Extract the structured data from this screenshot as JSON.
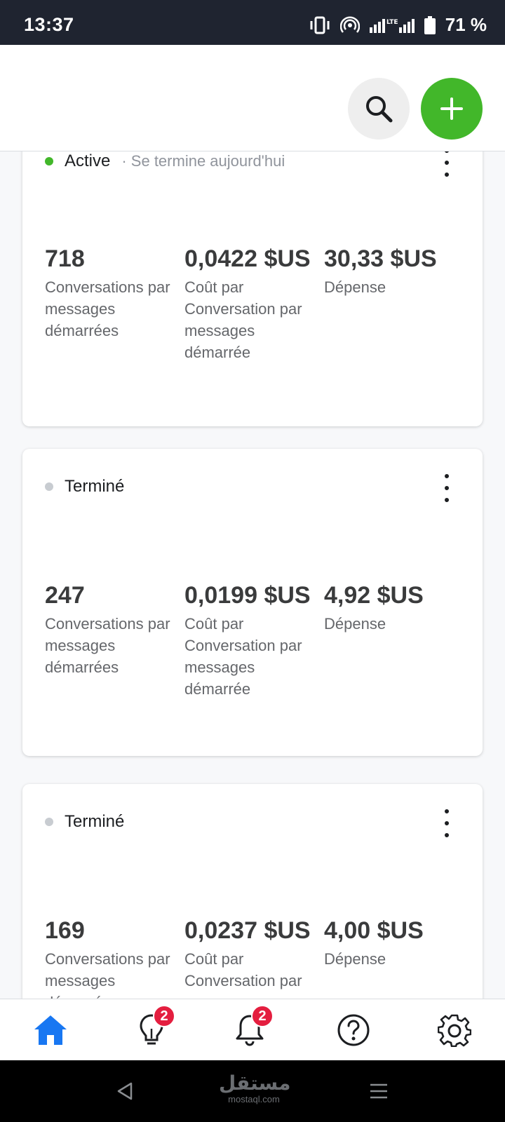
{
  "status_bar": {
    "time": "13:37",
    "battery": "71 %",
    "network": "LTE"
  },
  "header": {
    "search_icon": "search-icon",
    "create_icon": "plus-icon"
  },
  "cards": [
    {
      "status": "Active",
      "status_sub": "· Se termine aujourd'hui",
      "metrics": [
        {
          "value": "718",
          "label": "Conversations par messages démarrées"
        },
        {
          "value": "0,0422 $US",
          "label": "Coût par Conversation par messages démarrée"
        },
        {
          "value": "30,33 $US",
          "label": "Dépense"
        }
      ]
    },
    {
      "status": "Terminé",
      "metrics": [
        {
          "value": "247",
          "label": "Conversations par messages démarrées"
        },
        {
          "value": "0,0199 $US",
          "label": "Coût par Conversation par messages démarrée"
        },
        {
          "value": "4,92 $US",
          "label": "Dépense"
        }
      ]
    },
    {
      "status": "Terminé",
      "metrics": [
        {
          "value": "169",
          "label": "Conversations par messages démarrées"
        },
        {
          "value": "0,0237 $US",
          "label": "Coût par Conversation par messages démarrée"
        },
        {
          "value": "4,00 $US",
          "label": "Dépense"
        }
      ]
    }
  ],
  "bottom_nav": {
    "home_icon": "home-icon",
    "insights_icon": "lightbulb-icon",
    "insights_badge": "2",
    "notifications_icon": "bell-icon",
    "notifications_badge": "2",
    "help_icon": "help-icon",
    "settings_icon": "gear-icon",
    "active_color": "#1877f2"
  },
  "watermark": {
    "text_ar": "مستقل",
    "text_latin": "mostaql.com"
  }
}
